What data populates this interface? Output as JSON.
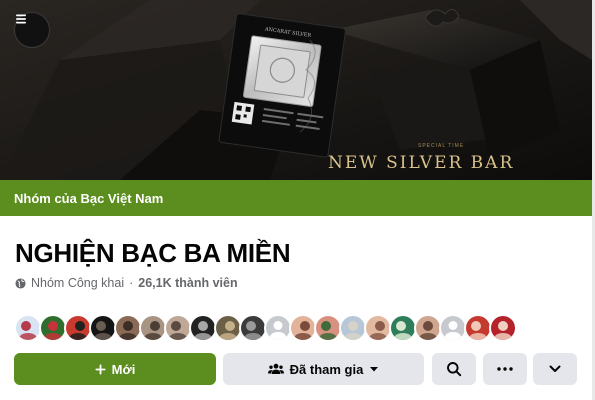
{
  "cover": {
    "promo_caption": "SPECIAL TIME",
    "promo_title": "NEW SILVER BAR",
    "package_brand": "ANCARAT SILVER",
    "menu_icon": "hamburger-menu-icon"
  },
  "group_bar": {
    "label": "Nhóm của Bạc Việt Nam",
    "color": "#5b8e1e"
  },
  "group": {
    "name": "NGHIỆN BẠC BA MIỀN",
    "privacy_icon": "globe-icon",
    "privacy": "Nhóm Công khai",
    "separator": "·",
    "members": "26,1K thành viên"
  },
  "members_preview": [
    {
      "kind": "photo",
      "colors": [
        "#d9e3f2",
        "#b53a4a"
      ]
    },
    {
      "kind": "photo",
      "colors": [
        "#2f6e2c",
        "#c8323a"
      ]
    },
    {
      "kind": "photo",
      "colors": [
        "#c83a2e",
        "#20201f"
      ]
    },
    {
      "kind": "photo",
      "colors": [
        "#151515",
        "#6a5d52"
      ]
    },
    {
      "kind": "photo",
      "colors": [
        "#8a6a55",
        "#3a2d26"
      ]
    },
    {
      "kind": "photo",
      "colors": [
        "#a89482",
        "#4b3e35"
      ]
    },
    {
      "kind": "photo",
      "colors": [
        "#bfa897",
        "#5a4a40"
      ]
    },
    {
      "kind": "photo",
      "colors": [
        "#222222",
        "#a8a8a8"
      ]
    },
    {
      "kind": "photo",
      "colors": [
        "#6d6048",
        "#c5b08a"
      ]
    },
    {
      "kind": "photo",
      "colors": [
        "#3b3b3b",
        "#9a9a9a"
      ]
    },
    {
      "kind": "default",
      "colors": [
        "#c6c9ce",
        "#8a8d91"
      ]
    },
    {
      "kind": "photo",
      "colors": [
        "#e2b39a",
        "#7a4b3a"
      ]
    },
    {
      "kind": "photo",
      "colors": [
        "#d89080",
        "#3d6b3a"
      ]
    },
    {
      "kind": "photo",
      "colors": [
        "#b7c7d8",
        "#d7d2c8"
      ]
    },
    {
      "kind": "photo",
      "colors": [
        "#e0b9a0",
        "#8a5a4a"
      ]
    },
    {
      "kind": "photo",
      "colors": [
        "#2e7d5b",
        "#d9e8d0"
      ]
    },
    {
      "kind": "photo",
      "colors": [
        "#cfa590",
        "#6b4a3c"
      ]
    },
    {
      "kind": "default",
      "colors": [
        "#c6c9ce",
        "#8a8d91"
      ]
    },
    {
      "kind": "photo",
      "colors": [
        "#c43a2e",
        "#f2c9b8"
      ]
    },
    {
      "kind": "photo",
      "colors": [
        "#b5222a",
        "#f0d0c0"
      ]
    }
  ],
  "actions": {
    "new_label": "Mới",
    "new_icon": "plus-icon",
    "joined_label": "Đã tham gia",
    "joined_icon": "people-icon",
    "joined_caret": "caret-down-icon",
    "search_icon": "search-icon",
    "more_icon": "ellipsis-icon",
    "expand_icon": "chevron-down-icon"
  }
}
